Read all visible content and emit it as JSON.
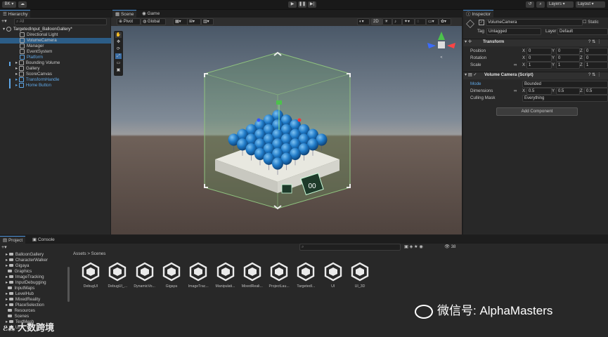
{
  "toolbar": {
    "account": "BK",
    "layers": "Layers",
    "layout": "Layout"
  },
  "hierarchy": {
    "tab": "Hierarchy",
    "search_placeholder": "All",
    "scene": "TargetedInput_BalloonGallery*",
    "items": [
      {
        "label": "Directional Light"
      },
      {
        "label": "VolumeCamera"
      },
      {
        "label": "Manager"
      },
      {
        "label": "EventSystem"
      },
      {
        "label": "Platform"
      },
      {
        "label": "Bounding Volume"
      },
      {
        "label": "Gallery"
      },
      {
        "label": "ScoreCanvas"
      },
      {
        "label": "TransformHandle"
      },
      {
        "label": "Home Button"
      }
    ]
  },
  "scene_view": {
    "tab_scene": "Scene",
    "tab_game": "Game",
    "pivot": "Pivot",
    "global": "Global",
    "mode_2d": "2D",
    "score": "00"
  },
  "inspector": {
    "tab": "Inspector",
    "object_name": "VolumeCamera",
    "static_label": "Static",
    "tag_label": "Tag",
    "tag_value": "Untagged",
    "layer_label": "Layer",
    "layer_value": "Default",
    "transform": {
      "title": "Transform",
      "rows": [
        {
          "label": "Position",
          "x": "0",
          "y": "0",
          "z": "0"
        },
        {
          "label": "Rotation",
          "x": "0",
          "y": "0",
          "z": "0"
        },
        {
          "label": "Scale",
          "x": "1",
          "y": "1",
          "z": "1"
        }
      ]
    },
    "volume_camera": {
      "title": "Volume Camera (Script)",
      "mode_label": "Mode",
      "mode_value": "Bounded",
      "dimensions_label": "Dimensions",
      "dim_x": "0.5",
      "dim_y": "0.5",
      "dim_z": "0.5",
      "culling_label": "Culling Mask",
      "culling_value": "Everything"
    },
    "add_component": "Add Component",
    "axis_x": "X",
    "axis_y": "Y",
    "axis_z": "Z"
  },
  "project": {
    "tab_project": "Project",
    "tab_console": "Console",
    "breadcrumb_root": "Assets",
    "breadcrumb_sep": ">",
    "breadcrumb_leaf": "Scenes",
    "count": "38",
    "folders": [
      "BalloonGallery",
      "CharacterWalker",
      "Gigaya",
      "Graphics",
      "ImageTracking",
      "InputDebugging",
      "InputMaps",
      "LevelHub",
      "MixedReality",
      "PlaceSelection",
      "Resources",
      "Scenes",
      "TextMesh",
      "UI"
    ],
    "assets": [
      "DebugUI",
      "DebugUI_...",
      "DynamicVo...",
      "Gigaya",
      "ImageTrac...",
      "Manipulati...",
      "MixedReali...",
      "ProjectLau...",
      "TargetedI...",
      "UI",
      "UI_3D"
    ]
  },
  "watermark": {
    "left": "大数跨境",
    "right": "微信号: AlphaMasters"
  }
}
